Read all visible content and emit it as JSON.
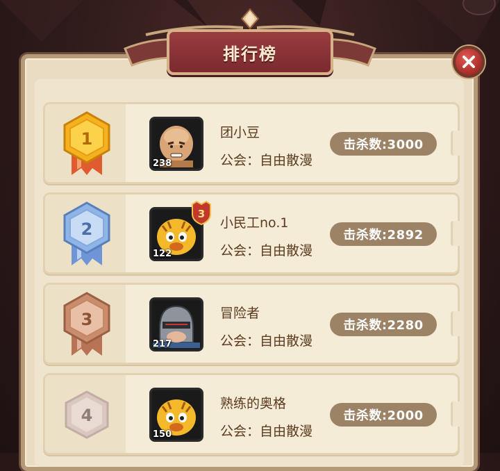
{
  "title": "排行榜",
  "close_label": "",
  "rows": [
    {
      "rank": "1",
      "name": "团小豆",
      "guild": "公会：自由散漫",
      "kills": "击杀数:3000",
      "level": "238",
      "medal": "gold",
      "avatar": "bald-monk-avatar"
    },
    {
      "rank": "2",
      "name": "小民工no.1",
      "guild": "公会：自由散漫",
      "kills": "击杀数:2892",
      "level": "122",
      "medal": "silver",
      "avatar": "tiger-avatar",
      "badge": "3"
    },
    {
      "rank": "3",
      "name": "冒险者",
      "guild": "公会：自由散漫",
      "kills": "击杀数:2280",
      "level": "217",
      "medal": "bronze",
      "avatar": "knight-helmet-avatar"
    },
    {
      "rank": "4",
      "name": "熟练的奥格",
      "guild": "公会：自由散漫",
      "kills": "击杀数:2000",
      "level": "150",
      "medal": "plain",
      "avatar": "tiger-avatar"
    }
  ],
  "colors": {
    "gold": "#f4b21e",
    "silver": "#8fb4e6",
    "bronze": "#c98d6d",
    "plain": "#d9c7c0",
    "kills_pill": "#9d8366",
    "banner": "#8a3236"
  }
}
